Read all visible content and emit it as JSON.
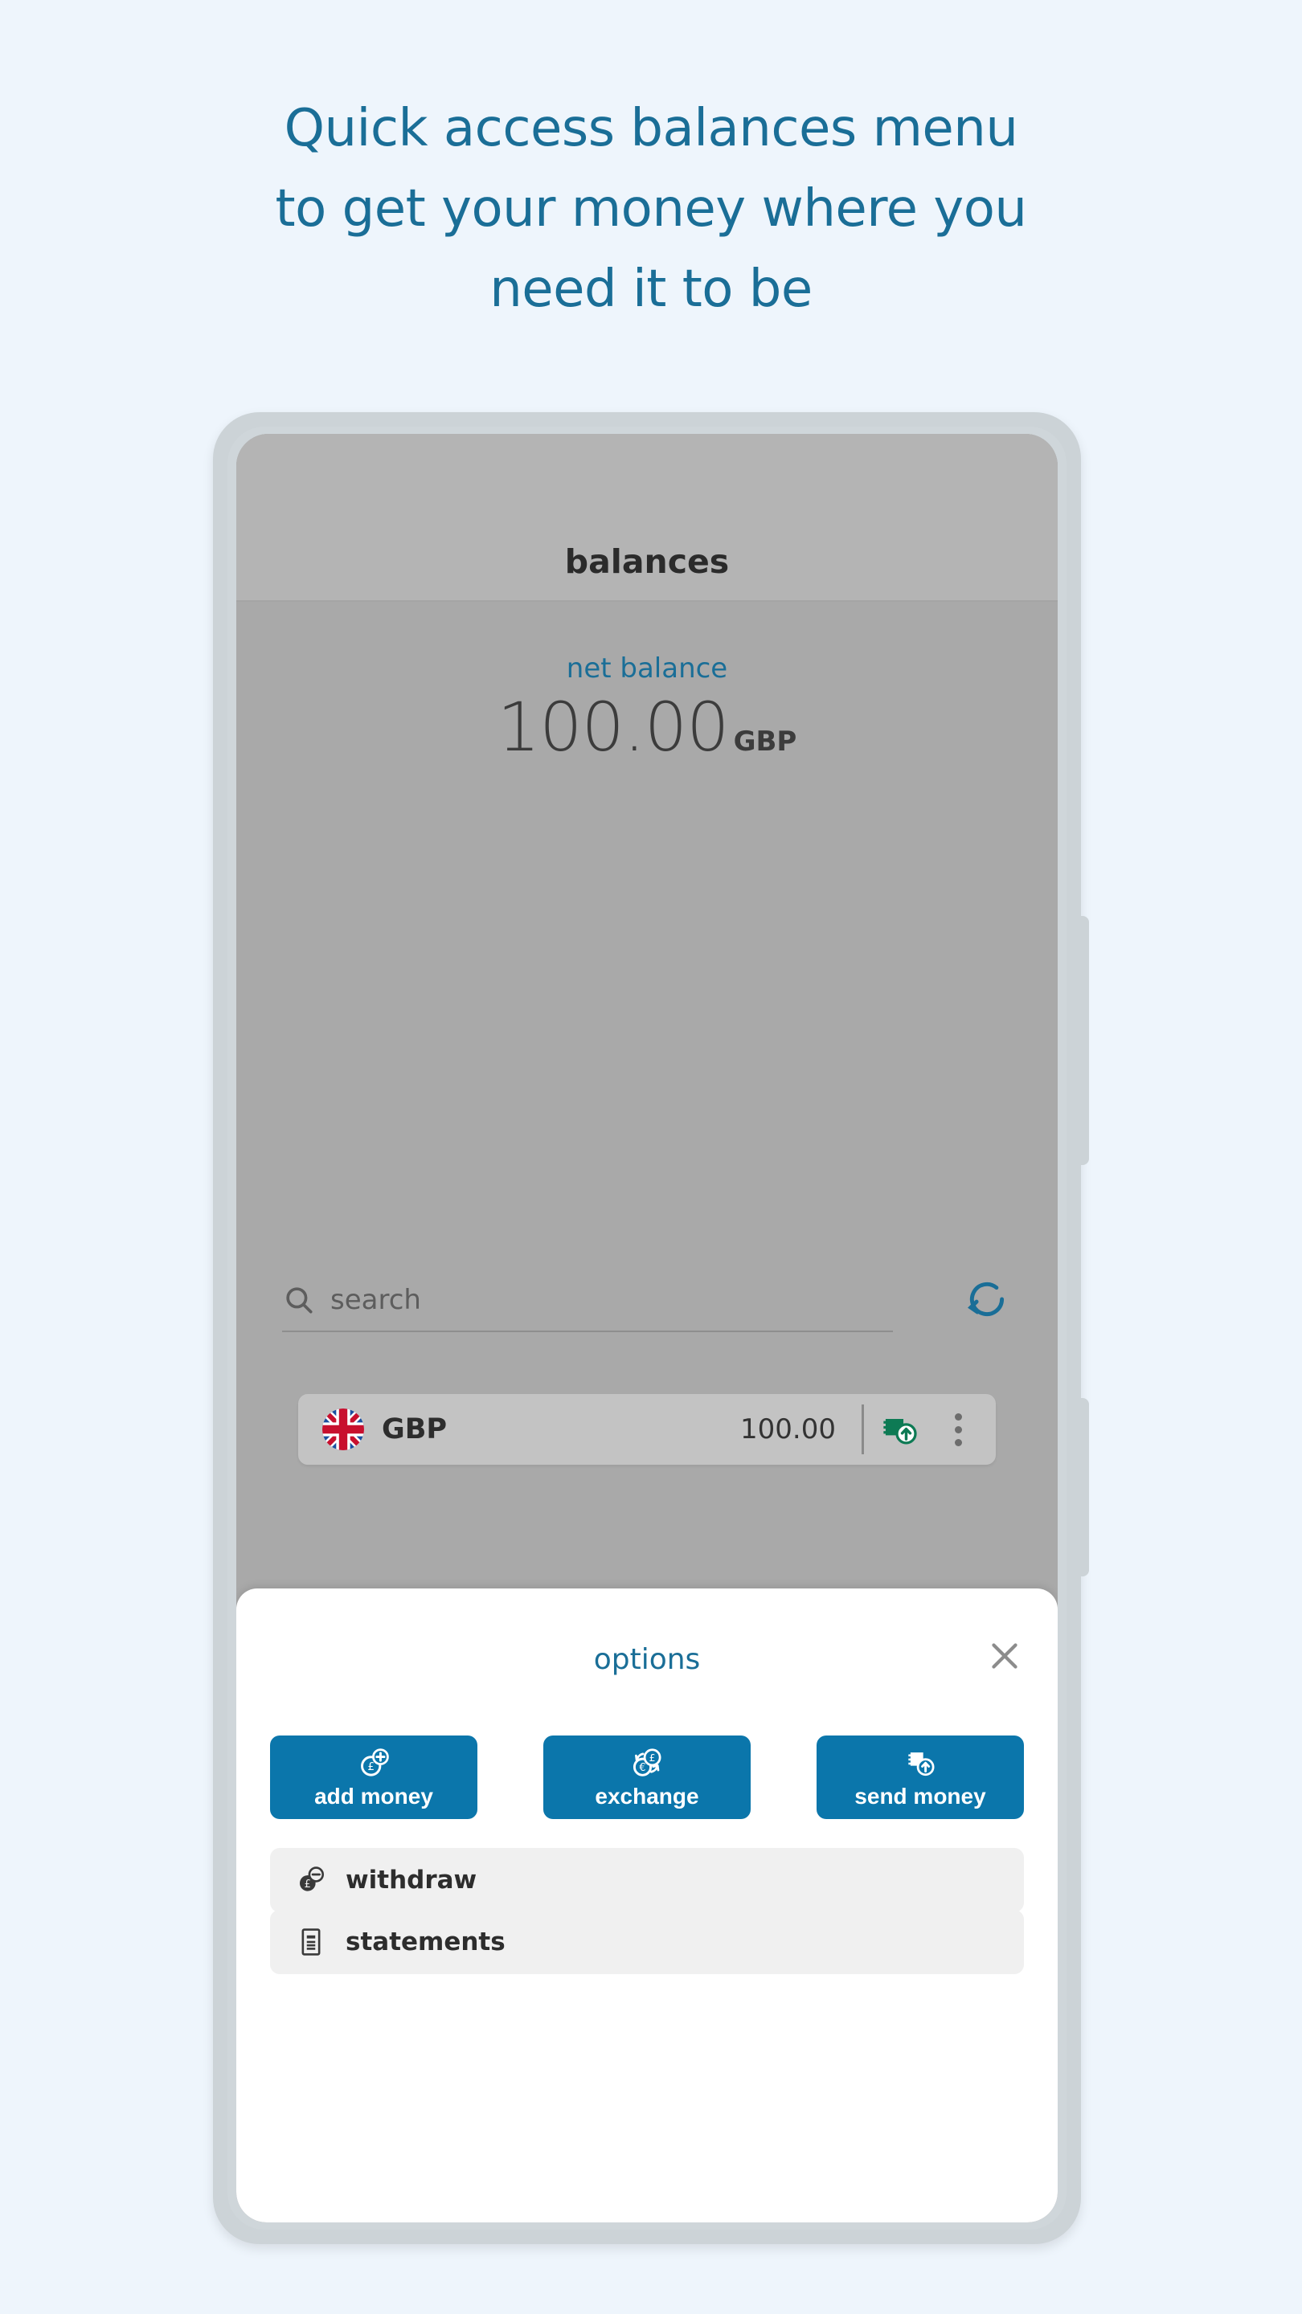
{
  "headline": {
    "line1": "Quick access balances menu",
    "line2": "to get your money where you",
    "line3": "need it to be",
    "color": "#1a6e97"
  },
  "phone": {
    "side_buttons": [
      "volume-rocker",
      "power-button"
    ]
  },
  "app": {
    "header": {
      "title": "balances"
    },
    "net_balance": {
      "label": "net balance",
      "amount": "100.00",
      "currency": "GBP"
    },
    "search": {
      "placeholder": "search",
      "value": "",
      "icon": "search-icon",
      "refresh_icon": "refresh-icon"
    },
    "balances": [
      {
        "flag": "uk-flag-icon",
        "code": "GBP",
        "amount": "100.00",
        "action_icon": "send-money-icon",
        "more_icon": "more-vertical-icon"
      }
    ]
  },
  "options_sheet": {
    "title": "options",
    "close_icon": "close-icon",
    "actions": [
      {
        "label": "add money",
        "icon": "coin-plus-icon"
      },
      {
        "label": "exchange",
        "icon": "currency-exchange-icon"
      },
      {
        "label": "send money",
        "icon": "banknote-up-icon"
      }
    ],
    "list": [
      {
        "label": "withdraw",
        "icon": "coin-minus-icon"
      },
      {
        "label": "statements",
        "icon": "document-icon"
      }
    ]
  },
  "colors": {
    "page_background": "#eef5fc",
    "accent_blue": "#0b76ab",
    "heading_blue": "#1a6e97",
    "screen_gray": "#a9a9a9",
    "header_gray": "#b4b4b4",
    "card_gray": "#c3c3c3",
    "sheet_white": "#ffffff",
    "list_item_gray": "#f0f0f0",
    "money_green": "#0d7a54"
  }
}
